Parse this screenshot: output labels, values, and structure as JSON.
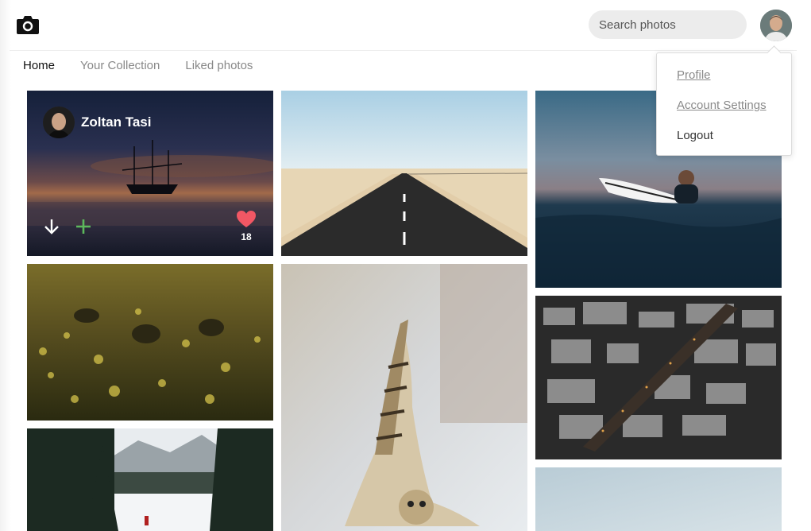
{
  "header": {
    "logo_icon": "camera-icon",
    "search": {
      "placeholder": "Search photos"
    },
    "avatar_icon": "user-avatar"
  },
  "nav": {
    "tabs": [
      {
        "label": "Home",
        "active": true
      },
      {
        "label": "Your Collection",
        "active": false
      },
      {
        "label": "Liked photos",
        "active": false
      }
    ]
  },
  "user_menu": {
    "items": [
      {
        "label": "Profile"
      },
      {
        "label": "Account Settings"
      },
      {
        "label": "Logout"
      }
    ]
  },
  "photos": [
    {
      "subject": "ship-sunset",
      "author": "Zoltan Tasi",
      "likes": "18",
      "hovered": true,
      "icons": [
        "download-icon",
        "add-to-collection-icon",
        "heart-icon"
      ]
    },
    {
      "subject": "desert-road"
    },
    {
      "subject": "surfer"
    },
    {
      "subject": "deer-field"
    },
    {
      "subject": "owl"
    },
    {
      "subject": "aerial-city"
    },
    {
      "subject": "snowy-forest"
    },
    {
      "subject": "sky"
    }
  ],
  "colors": {
    "accent_heart": "#f25764",
    "add_green": "#5cb85c",
    "search_bg": "#ececec"
  }
}
